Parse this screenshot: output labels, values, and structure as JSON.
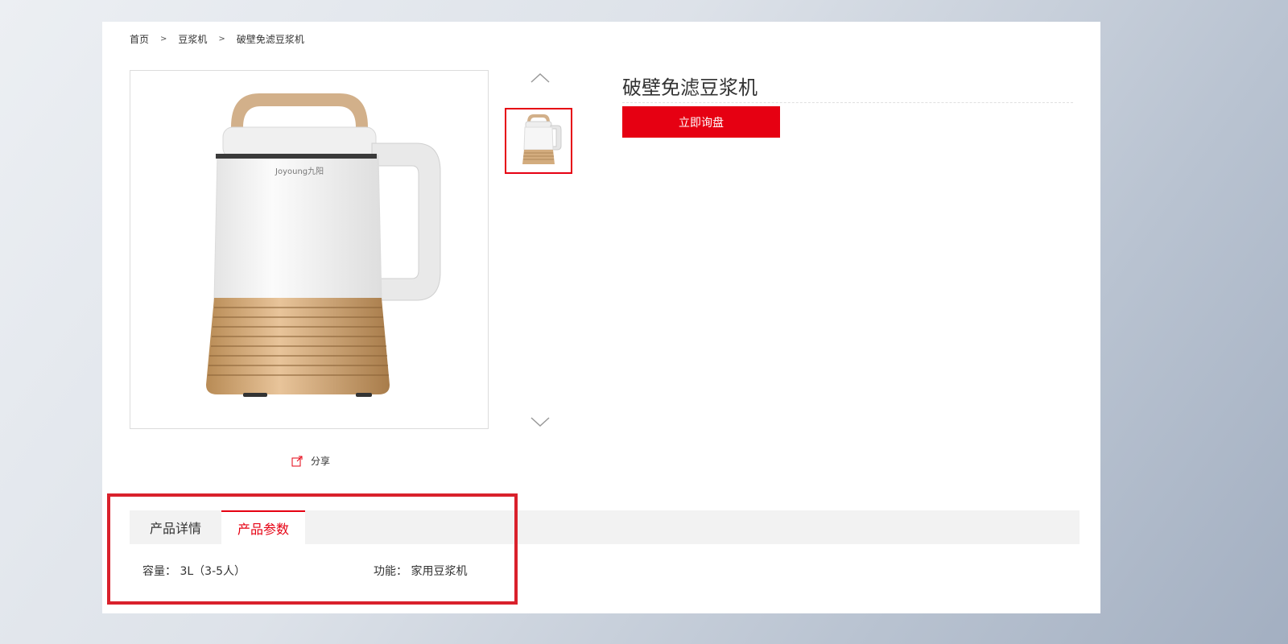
{
  "breadcrumb": {
    "home": "首页",
    "category": "豆浆机",
    "current": "破壁免滤豆浆机",
    "separator": ">"
  },
  "product": {
    "title": "破壁免滤豆浆机",
    "inquiry_button": "立即询盘",
    "image_brand_text": "Joyoung九阳"
  },
  "share": {
    "label": "分享",
    "icon": "share-icon"
  },
  "tabs": [
    {
      "label": "产品详情",
      "active": false
    },
    {
      "label": "产品参数",
      "active": true
    }
  ],
  "params": [
    {
      "label": "容量：",
      "value": "3L（3-5人）"
    },
    {
      "label": "功能：",
      "value": "家用豆浆机"
    }
  ],
  "colors": {
    "accent": "#e60012",
    "highlight": "#d9212c",
    "tab_bar": "#f2f2f2"
  }
}
